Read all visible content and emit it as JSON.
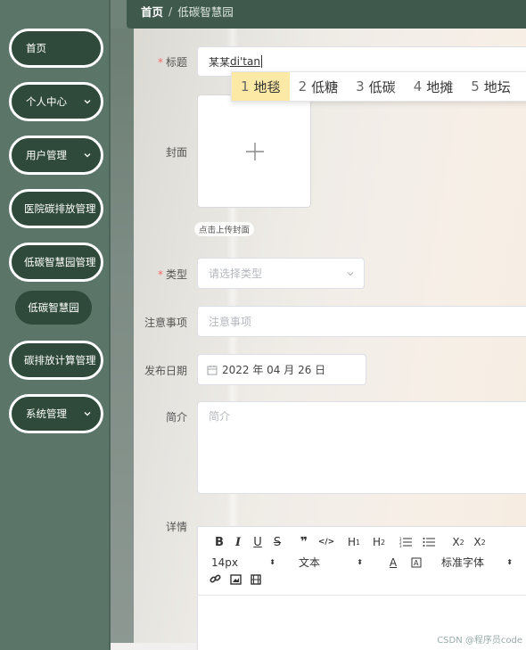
{
  "sidebar": {
    "items": [
      {
        "label": "首页",
        "has_chevron": false
      },
      {
        "label": "个人中心",
        "has_chevron": true
      },
      {
        "label": "用户管理",
        "has_chevron": true
      },
      {
        "label": "医院碳排放管理",
        "has_chevron": false
      },
      {
        "label": "低碳智慧园管理",
        "has_chevron": false
      },
      {
        "label": "碳排放计算管理",
        "has_chevron": false
      },
      {
        "label": "系统管理",
        "has_chevron": true
      }
    ],
    "submenu": {
      "label": "低碳智慧园"
    }
  },
  "breadcrumb": {
    "home": "首页",
    "separator": "/",
    "current": "低碳智慧园"
  },
  "form": {
    "title": {
      "label": "标题",
      "value_prefix": "某某",
      "value_composing": "di'tan"
    },
    "ime_candidates": [
      {
        "num": "1",
        "text": "地毯"
      },
      {
        "num": "2",
        "text": "低糖"
      },
      {
        "num": "3",
        "text": "低碳"
      },
      {
        "num": "4",
        "text": "地摊"
      },
      {
        "num": "5",
        "text": "地坛"
      }
    ],
    "cover": {
      "label": "封面",
      "hint": "点击上传封面"
    },
    "type": {
      "label": "类型",
      "placeholder": "请选择类型"
    },
    "notes": {
      "label": "注意事项",
      "placeholder": "注意事项"
    },
    "date": {
      "label": "发布日期",
      "value": "2022 年 04 月 26 日"
    },
    "intro": {
      "label": "简介",
      "placeholder": "简介"
    },
    "details": {
      "label": "详情"
    }
  },
  "editor": {
    "font_size": "14px",
    "paragraph": "文本",
    "font_family": "标准字体"
  },
  "watermark": "CSDN @程序员code",
  "colors": {
    "sidebar": "#5b7568",
    "pill": "#2f4a3a",
    "topbar": "#3f5a4c",
    "required": "#f56c6c",
    "ime_selected": "#fde9a6"
  }
}
